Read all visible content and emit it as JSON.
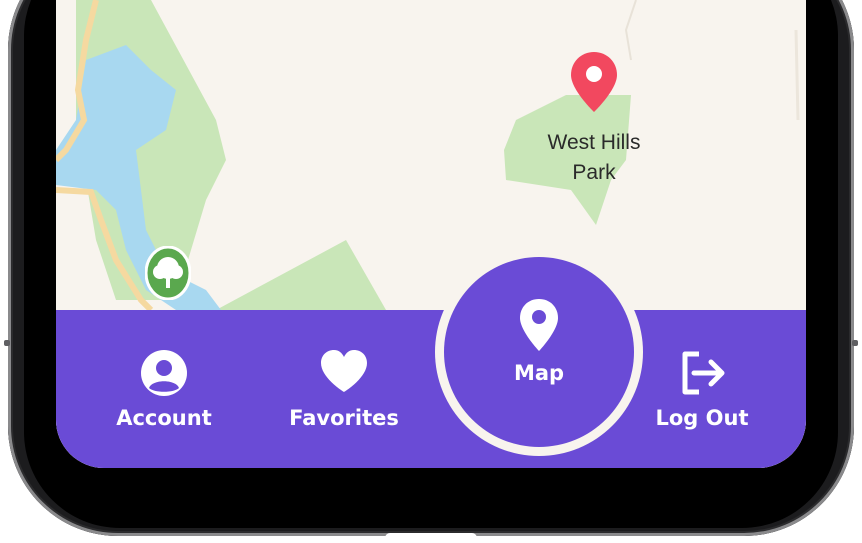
{
  "map": {
    "place_label_line1": "West Hills",
    "place_label_line2": "Park",
    "pin_color": "#f2485f",
    "park_color": "#c9e6b8",
    "water_color": "#a8d8f0",
    "land_color": "#f8f4ee",
    "road_color": "#f5d9a0",
    "tree_marker_color": "#5aa84e"
  },
  "nav": {
    "background": "#6a4bd6",
    "items": [
      {
        "label": "Account",
        "icon": "user-circle-icon"
      },
      {
        "label": "Favorites",
        "icon": "heart-icon"
      },
      {
        "label": "Map",
        "icon": "location-pin-icon",
        "active": true
      },
      {
        "label": "Log Out",
        "icon": "logout-icon"
      }
    ]
  }
}
